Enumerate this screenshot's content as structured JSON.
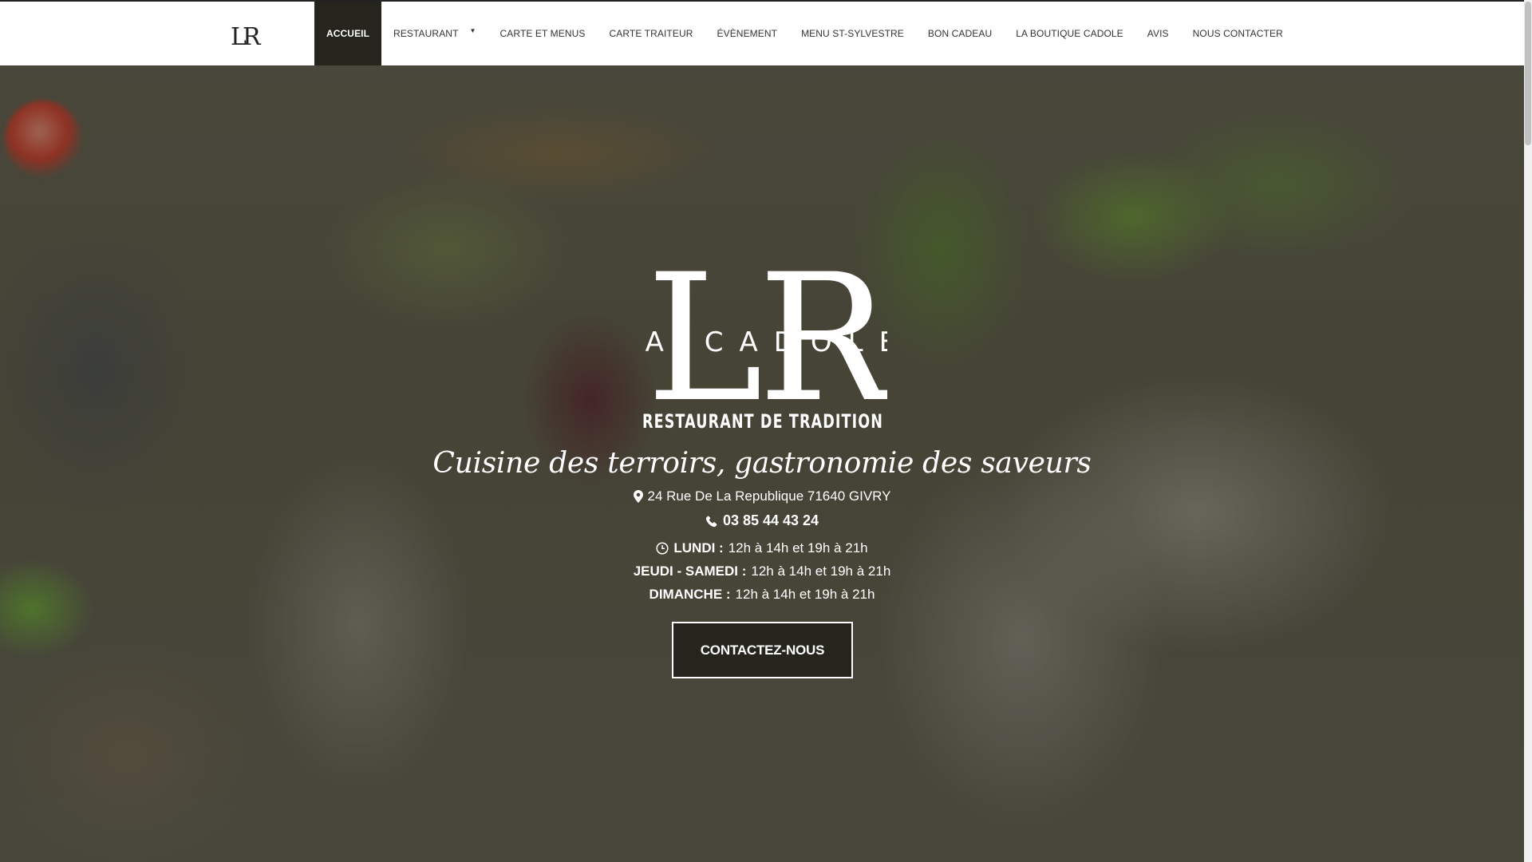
{
  "brand": {
    "name": "LA CADOLE",
    "subtitle": "RESTAURANT DE TRADITION",
    "monogram": "LR"
  },
  "nav": {
    "items": [
      {
        "label": "ACCUEIL",
        "active": true
      },
      {
        "label": "RESTAURANT",
        "has_dropdown": true
      },
      {
        "label": "CARTE ET MENUS"
      },
      {
        "label": "CARTE TRAITEUR"
      },
      {
        "label": "ÉVÈNEMENT"
      },
      {
        "label": "MENU ST-SYLVESTRE"
      },
      {
        "label": "BON CADEAU"
      },
      {
        "label": "LA BOUTIQUE CADOLE"
      },
      {
        "label": "AVIS"
      },
      {
        "label": "NOUS CONTACTER"
      }
    ]
  },
  "hero": {
    "tagline": "Cuisine des terroirs, gastronomie des saveurs",
    "address": "24 Rue De La Republique 71640 GIVRY",
    "phone": "03 85 44 43 24",
    "hours": [
      {
        "day": "LUNDI :",
        "time": "12h à 14h et 19h à 21h"
      },
      {
        "day": "JEUDI - SAMEDI :",
        "time": "12h à 14h et 19h à 21h"
      },
      {
        "day": "DIMANCHE :",
        "time": "12h à 14h et 19h à 21h"
      }
    ],
    "cta_label": "CONTACTEZ-NOUS"
  },
  "icons": {
    "location": "map-pin-icon",
    "phone": "phone-icon",
    "clock": "clock-icon"
  },
  "colors": {
    "nav_active_bg": "#25241d",
    "cta_bg": "#25241d",
    "text_light": "#ffffff"
  }
}
